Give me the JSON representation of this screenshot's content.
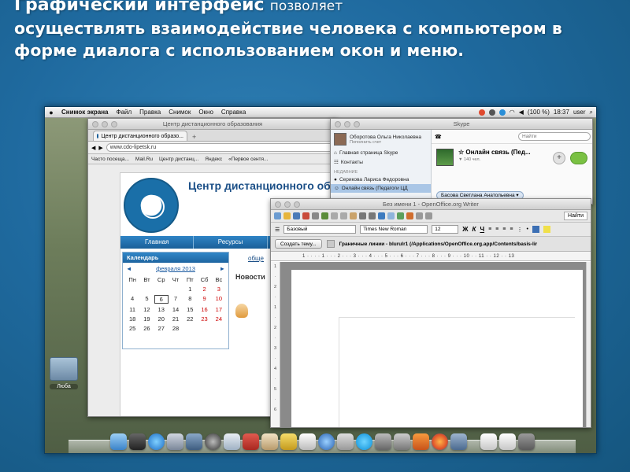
{
  "slide": {
    "title_bold": "Графический интерфейс",
    "title_rest": "позволяет",
    "body": "осуществлять взаимодействие человека с компьютером в форме диалога с использованием окон и меню."
  },
  "menubar": {
    "apple": "",
    "items": [
      "Снимок экрана",
      "Файл",
      "Правка",
      "Снимок",
      "Окно",
      "Справка"
    ],
    "battery": "(100 %)",
    "clock": "18:37",
    "user": "user"
  },
  "desktop": {
    "folder_label": "Люба"
  },
  "browser": {
    "window_title": "Центр дистанционного образования",
    "tab_label": "Центр дистанционного образо...",
    "url": "www.cdo-lipetsk.ru",
    "bookmarks": [
      "Часто посеща...",
      "Mail.Ru",
      "Центр дистанц...",
      "Яндекс",
      "«Первое сентя..."
    ],
    "site_title": "Центр дистанционного обр",
    "nav": [
      "Главная",
      "Ресурсы",
      "П"
    ],
    "calendar": {
      "header": "Календарь",
      "month": "февраля 2013",
      "days": [
        "Пн",
        "Вт",
        "Ср",
        "Чт",
        "Пт",
        "Сб",
        "Вс"
      ],
      "rows": [
        [
          "",
          "",
          "",
          "",
          "1",
          "2",
          "3"
        ],
        [
          "4",
          "5",
          "6",
          "7",
          "8",
          "9",
          "10"
        ],
        [
          "11",
          "12",
          "13",
          "14",
          "15",
          "16",
          "17"
        ],
        [
          "18",
          "19",
          "20",
          "21",
          "22",
          "23",
          "24"
        ],
        [
          "25",
          "26",
          "27",
          "28",
          "",
          "",
          ""
        ]
      ],
      "today": "6"
    },
    "news_link": "обще",
    "news_heading": "Новости"
  },
  "skype": {
    "window_title": "Skype",
    "user_name": "Оборотова Ольга Николаевна",
    "user_sub": "Пополнить счет",
    "items": [
      "Главная страница Skype",
      "Контакты"
    ],
    "recent_label": "НЕДАВНИЕ",
    "recent": [
      "Серикова Лариса Федоровна",
      "Онлайн связь (Педагоги ЦД"
    ],
    "search_placeholder": "Найти",
    "conv_title": "Онлайн связь (Пед...",
    "conv_count": "▼ 140 чел.",
    "participant": "Басова Светлана Анатольевна ▾"
  },
  "writer": {
    "window_title": "Без имени 1 - OpenOffice.org Writer",
    "find_label": "Найти",
    "style": "Базовый",
    "font": "Times New Roman",
    "size": "12",
    "format_buttons": [
      "Ж",
      "К",
      "Ч"
    ],
    "theme_button": "Создать тему...",
    "path_text": "Граничные линии - blurulr1 (/Applications/OpenOffice.org.app/Contents/basis-lir",
    "ruler": "1 · · · · 1 · · · 2 · · · 3 · · · 4 · · · 5 · · · 6 · · · 7 · · · 8 · · · 9 · · · 10 · · 11 · · 12 · · 13",
    "vruler": [
      "1",
      "·",
      "2",
      "·",
      "1",
      "·",
      "2",
      "·",
      "3",
      "·",
      "4",
      "·",
      "5",
      "·",
      "6"
    ]
  },
  "colors": {
    "slide_bg": "#1f6a9f",
    "site_accent": "#1a5f99",
    "skype_call": "#7ac143"
  }
}
